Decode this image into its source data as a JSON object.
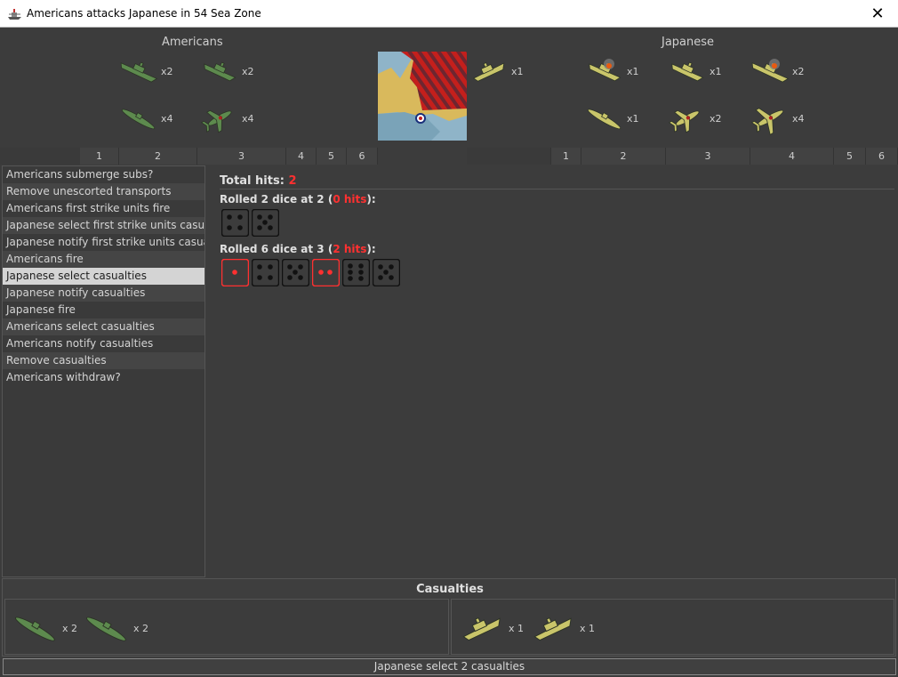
{
  "window": {
    "title": "Americans attacks Japanese in 54 Sea Zone",
    "close_label": "✕"
  },
  "attacker": {
    "label": "Americans",
    "units": [
      {
        "name": "battleship",
        "count": "x2"
      },
      {
        "name": "destroyer",
        "count": "x2"
      },
      {
        "name": "submarine",
        "count": "x4"
      },
      {
        "name": "fighter",
        "count": "x4"
      }
    ]
  },
  "defender": {
    "label": "Japanese",
    "units": [
      {
        "name": "transport",
        "count": "x1"
      },
      {
        "name": "damaged-carrier",
        "count": "x1"
      },
      {
        "name": "destroyer",
        "count": "x1"
      },
      {
        "name": "damaged-battleship",
        "count": "x2"
      },
      {
        "name": "submarine",
        "count": "x1"
      },
      {
        "name": "fighter",
        "count": "x2"
      },
      {
        "name": "bomber",
        "count": "x4"
      }
    ]
  },
  "attacker_columns": [
    "1",
    "2",
    "3",
    "4",
    "5",
    "6"
  ],
  "defender_columns": [
    "1",
    "2",
    "3",
    "4",
    "5",
    "6"
  ],
  "steps": [
    "Americans submerge subs?",
    "Remove unescorted transports",
    "Americans first strike units fire",
    "Japanese select first strike units casualties",
    "Japanese notify first strike units casualties",
    "Americans fire",
    "Japanese select casualties",
    "Japanese notify casualties",
    "Japanese fire",
    "Americans select casualties",
    "Americans notify casualties",
    "Remove casualties",
    "Americans withdraw?"
  ],
  "selected_step_index": 6,
  "dice": {
    "total_label": "Total hits:",
    "total_value": "2",
    "rolls": [
      {
        "prefix": "Rolled 2 dice at 2 (",
        "hits": "0 hits",
        "suffix": "):",
        "values": [
          4,
          5
        ],
        "hit_flags": [
          false,
          false
        ]
      },
      {
        "prefix": "Rolled 6 dice at 3 (",
        "hits": "2 hits",
        "suffix": "):",
        "values": [
          1,
          4,
          5,
          2,
          6,
          5
        ],
        "hit_flags": [
          true,
          false,
          false,
          true,
          false,
          false
        ]
      }
    ]
  },
  "casualties": {
    "title": "Casualties",
    "attacker": [
      {
        "name": "submarine",
        "count": "x 2"
      },
      {
        "name": "submarine",
        "count": "x 2"
      }
    ],
    "defender": [
      {
        "name": "transport",
        "count": "x 1"
      },
      {
        "name": "transport",
        "count": "x 1"
      }
    ]
  },
  "status": "Japanese select 2 casualties",
  "colors": {
    "us_unit": "#5d8a4e",
    "jp_unit": "#c9c56a",
    "hit": "#ff3030",
    "territory_sea": "#8fb4c8",
    "territory_land": "#d9b95c",
    "territory_stripe": "#c0201c"
  }
}
